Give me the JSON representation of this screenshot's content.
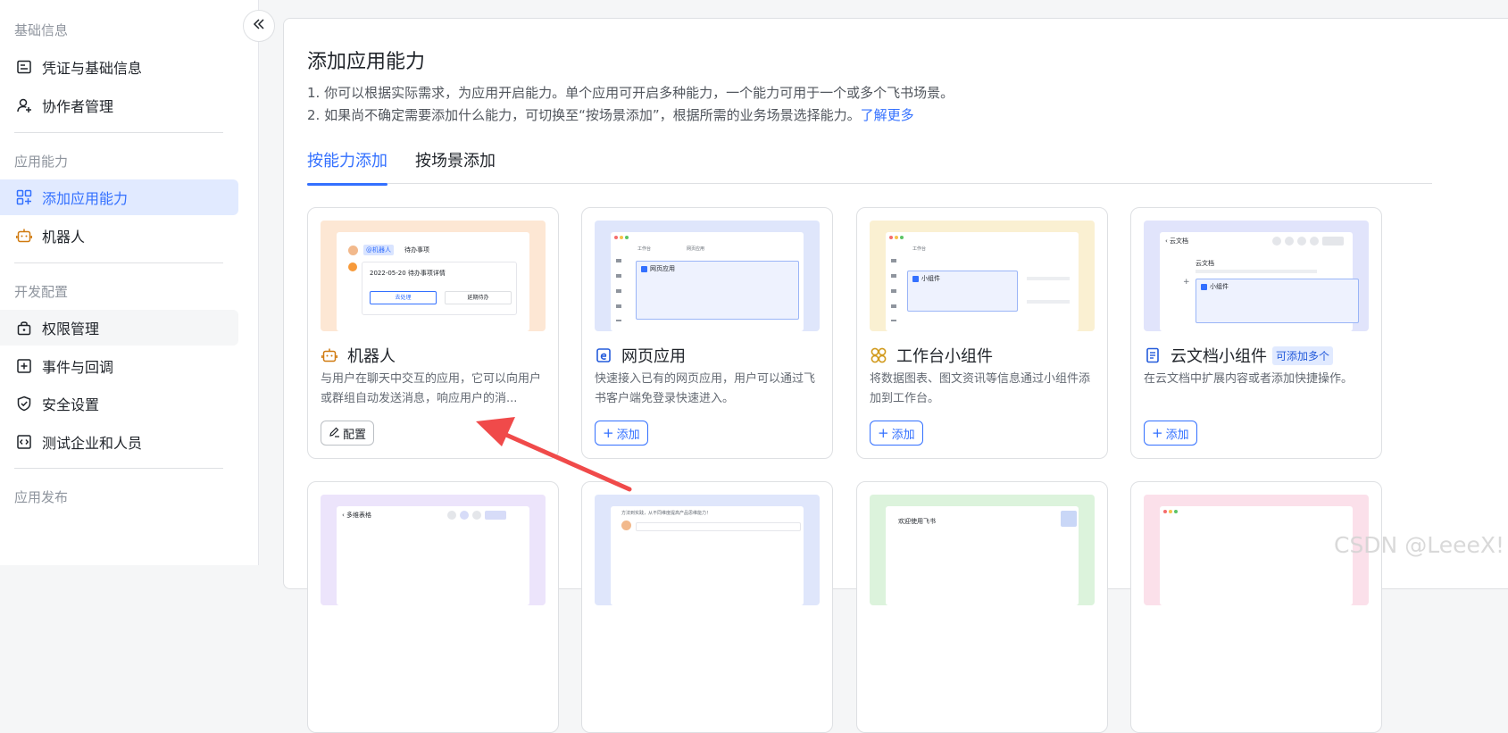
{
  "sidebar": {
    "section_basic": "基础信息",
    "item_credentials": "凭证与基础信息",
    "item_collaborators": "协作者管理",
    "section_capability": "应用能力",
    "item_add_capability": "添加应用能力",
    "item_bot": "机器人",
    "section_dev": "开发配置",
    "item_permissions": "权限管理",
    "item_events": "事件与回调",
    "item_security": "安全设置",
    "item_test": "测试企业和人员",
    "section_release": "应用发布"
  },
  "main": {
    "title": "添加应用能力",
    "desc1": "1. 你可以根据实际需求，为应用开启能力。单个应用可开启多种能力，一个能力可用于一个或多个飞书场景。",
    "desc2": "2. 如果尚不确定需要添加什么能力，可切换至“按场景添加”，根据所需的业务场景选择能力。",
    "learn_more": "了解更多",
    "tab_by_capability": "按能力添加",
    "tab_by_scenario": "按场景添加"
  },
  "cards": {
    "bot": {
      "title": "机器人",
      "desc": "与用户在聊天中交互的应用，它可以向用户或群组自动发送消息，响应用户的消...",
      "button": "配置",
      "mock_tag": "@机器人",
      "mock_header": "待办事项",
      "mock_line": "2022-05-20 待办事项详情",
      "mock_btn1": "去处理",
      "mock_btn2": "延期待办"
    },
    "web": {
      "title": "网页应用",
      "desc": "快速接入已有的网页应用，用户可以通过飞书客户端免登录快速进入。",
      "button": "添加",
      "mock_tab1": "工作台",
      "mock_tab2": "网页应用",
      "mock_label": "网页应用"
    },
    "widget": {
      "title": "工作台小组件",
      "desc": "将数据图表、图文资讯等信息通过小组件添加到工作台。",
      "button": "添加",
      "mock_tab1": "工作台",
      "mock_label": "小组件"
    },
    "docs": {
      "title": "云文档小组件",
      "tag": "可添加多个",
      "desc": "在云文档中扩展内容或者添加快捷操作。",
      "button": "添加",
      "mock_header": "云文档",
      "mock_doc": "云文档",
      "mock_label": "小组件"
    },
    "row2": {
      "mock1_header": "多维表格",
      "mock2_header": "方法到实践，从不同维度提高产品思维能力！",
      "mock3_header": "欢迎使用飞书"
    }
  },
  "icons": {
    "collapse": "double-chevron-left-icon",
    "credentials": "id-card-icon",
    "collaborators": "user-plus-icon",
    "add_capability": "grid-plus-icon",
    "bot": "robot-icon",
    "permissions": "lock-icon",
    "events": "plus-square-icon",
    "security": "shield-check-icon",
    "test": "code-icon",
    "web": "web-e-icon",
    "widget": "clover-icon",
    "docs": "document-icon",
    "edit": "pencil-icon",
    "add": "plus-icon"
  },
  "watermark": "CSDN @LeeeX!",
  "colors": {
    "accent": "#3370ff",
    "active_bg": "#e1eaff",
    "annotation_arrow": "#f04a4a",
    "bot_thumb": "#fde7d4",
    "web_thumb": "#dfe6fb",
    "widget_thumb": "#faf0d2",
    "docs_thumb": "#e1e4fb"
  }
}
